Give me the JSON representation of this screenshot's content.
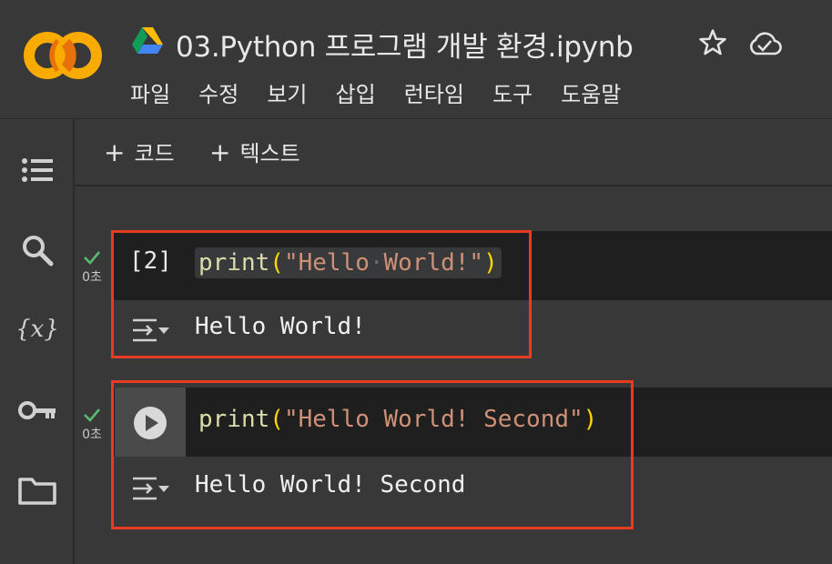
{
  "header": {
    "title": "03.Python 프로그램 개발 환경.ipynb",
    "logo_icon": "colab-logo",
    "drive_icon": "google-drive-icon",
    "star_icon": "star-icon",
    "cloud_icon": "cloud-saved-icon"
  },
  "menu": {
    "items": [
      "파일",
      "수정",
      "보기",
      "삽입",
      "런타임",
      "도구",
      "도움말"
    ]
  },
  "toolbar": {
    "add_code": "코드",
    "add_text": "텍스트",
    "plus": "+"
  },
  "sidebar": {
    "icons": [
      "table-of-contents-icon",
      "search-icon",
      "variables-icon",
      "secrets-key-icon",
      "files-folder-icon"
    ]
  },
  "cells": [
    {
      "exec_count": "[2]",
      "code_fn": "print",
      "code_open": "(",
      "code_str_a": "\"Hello",
      "code_ws": "·",
      "code_str_b": "World!\"",
      "code_close": ")",
      "output": "Hello World!",
      "status_time": "0초"
    },
    {
      "code_fn": "print",
      "code_open": "(",
      "code_str": "\"Hello World! Second\"",
      "code_close": ")",
      "output": "Hello World! Second",
      "status_time": "0초"
    }
  ],
  "colors": {
    "highlight": "#e53c22",
    "check": "#5bb974",
    "string": "#ce9178",
    "function": "#dcdcaa",
    "paren": "#ffd700"
  }
}
